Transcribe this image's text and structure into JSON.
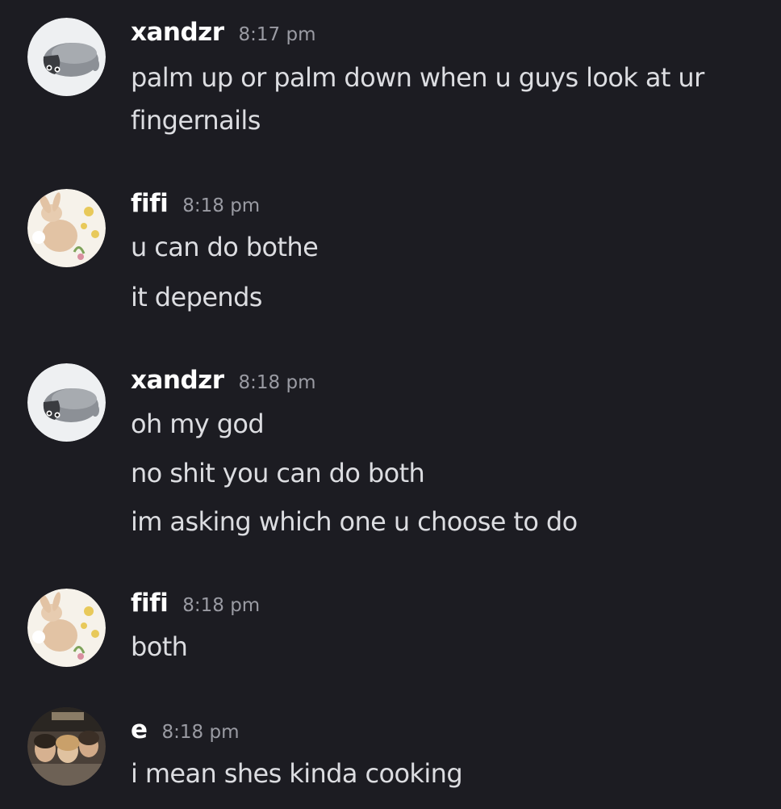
{
  "messages": [
    {
      "username": "xandzr",
      "time": "8:17 pm",
      "avatar": "penguin-avatar",
      "lines": [
        "palm up or palm down when u guys look at ur",
        "fingernails"
      ]
    },
    {
      "username": "fifi",
      "time": "8:18 pm",
      "avatar": "bunny-avatar",
      "lines": [
        "u can do bothe",
        "it depends"
      ]
    },
    {
      "username": "xandzr",
      "time": "8:18 pm",
      "avatar": "penguin-avatar",
      "lines": [
        "oh my god",
        "no shit you can do both",
        "im asking which one u choose to do"
      ]
    },
    {
      "username": "fifi",
      "time": "8:18 pm",
      "avatar": "bunny-avatar",
      "lines": [
        "both"
      ]
    },
    {
      "username": "e",
      "time": "8:18 pm",
      "avatar": "group-photo-avatar",
      "lines": [
        "i mean shes kinda cooking"
      ]
    }
  ],
  "colors": {
    "background": "#1c1c22",
    "username": "#ffffff",
    "timestamp": "#9a9ba3",
    "message_text": "#dcdde1"
  }
}
